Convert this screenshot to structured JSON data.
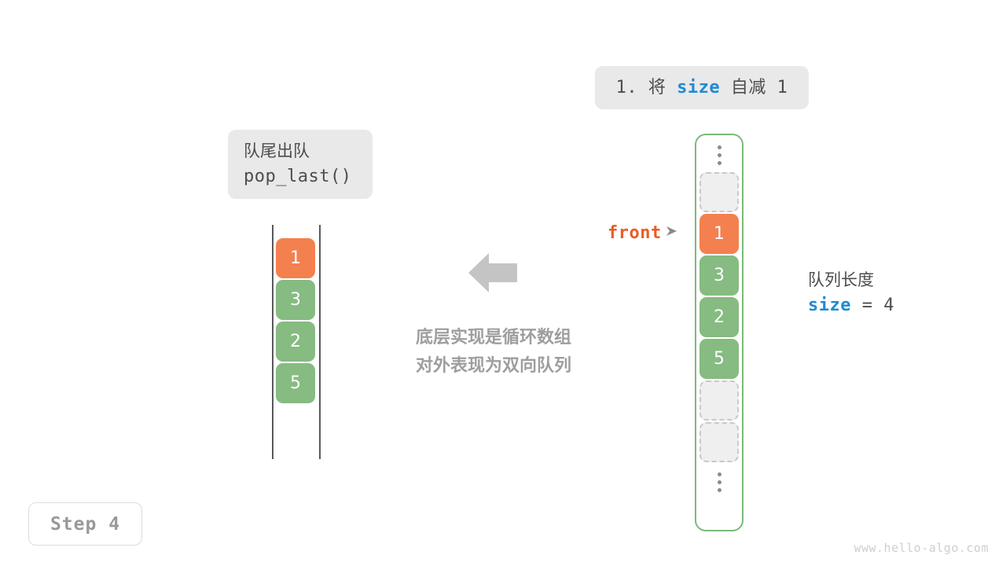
{
  "operation_badge": {
    "prefix": "1. 将 ",
    "keyword": "size",
    "suffix": " 自减 1"
  },
  "method_badge": {
    "title": "队尾出队",
    "code": "pop_last()"
  },
  "left_deque": {
    "name": "双向队列",
    "cells": [
      {
        "value": "1",
        "color": "#f4804f"
      },
      {
        "value": "3",
        "color": "#86bb82"
      },
      {
        "value": "2",
        "color": "#86bb82"
      },
      {
        "value": "5",
        "color": "#86bb82"
      }
    ]
  },
  "center": {
    "arrow_direction": "left",
    "caption_line1": "底层实现是循环数组",
    "caption_line2": "对外表现为双向队列"
  },
  "front_pointer": {
    "label": "front"
  },
  "circular_array": {
    "top_ellipsis": "⋮",
    "bottom_ellipsis": "⋮",
    "slots": [
      {
        "value": "",
        "state": "empty"
      },
      {
        "value": "1",
        "state": "filled",
        "color": "#f4804f"
      },
      {
        "value": "3",
        "state": "filled",
        "color": "#86bb82"
      },
      {
        "value": "2",
        "state": "filled",
        "color": "#86bb82"
      },
      {
        "value": "5",
        "state": "filled",
        "color": "#86bb82"
      },
      {
        "value": "",
        "state": "empty"
      },
      {
        "value": "",
        "state": "empty"
      }
    ]
  },
  "size_info": {
    "label": "队列长度",
    "var_name": "size",
    "equals": " = ",
    "value": "4"
  },
  "step_badge": {
    "text": "Step 4"
  },
  "watermark": {
    "text": "www.hello-algo.com"
  },
  "colors": {
    "orange": "#f4804f",
    "green": "#86bb82",
    "blue": "#1f8ad1",
    "front_orange": "#ed5b23",
    "badge_bg": "#e9e9e9",
    "gray_text": "#4d4d4d",
    "caption_gray": "#9e9e9e",
    "empty_fill": "#efefef",
    "empty_border": "#c9c9c9",
    "array_border": "#7cb97b"
  }
}
